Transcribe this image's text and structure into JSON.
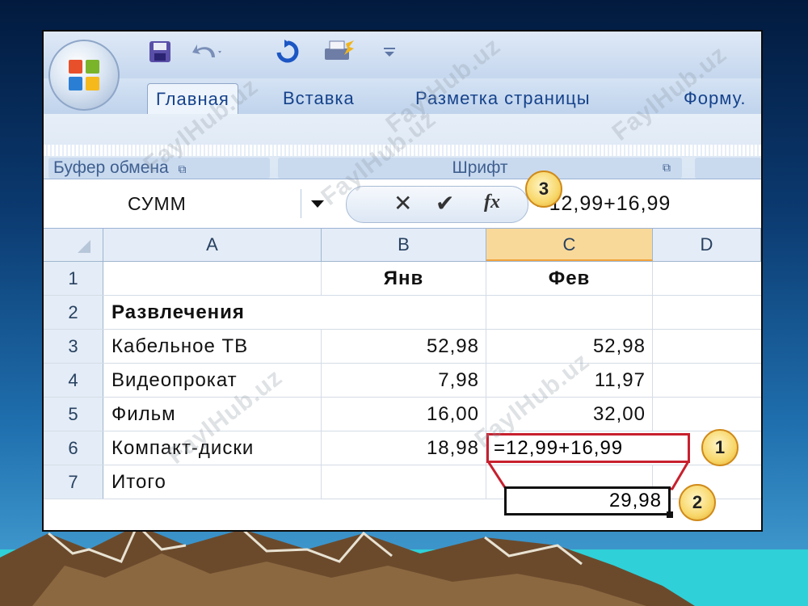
{
  "quick_access": {
    "icons": [
      "office-logo",
      "save-icon",
      "undo-icon",
      "redo-icon",
      "print-icon",
      "customize-icon"
    ]
  },
  "tabs": [
    "Главная",
    "Вставка",
    "Разметка страницы",
    "Форму."
  ],
  "ribbon": {
    "groups": [
      {
        "label": "Буфер обмена",
        "launcher": "⧉"
      },
      {
        "label": "Шрифт",
        "launcher": "⧉"
      }
    ]
  },
  "formula_bar": {
    "name_box": "СУММ",
    "cancel_icon": "✕",
    "enter_icon": "✔",
    "fx_label": "fx",
    "formula": "=12,99+16,99"
  },
  "sheet": {
    "columns": [
      "A",
      "B",
      "C",
      "D"
    ],
    "selected_column": "C",
    "rows": [
      {
        "num": "1",
        "a": "",
        "b": "Янв",
        "c": "Фев"
      },
      {
        "num": "2",
        "a": "Развлечения",
        "b": "",
        "c": ""
      },
      {
        "num": "3",
        "a": "Кабельное ТВ",
        "b": "52,98",
        "c": "52,98"
      },
      {
        "num": "4",
        "a": "Видеопрокат",
        "b": "7,98",
        "c": "11,97"
      },
      {
        "num": "5",
        "a": "Фильм",
        "b": "16,00",
        "c": "32,00"
      },
      {
        "num": "6",
        "a": "Компакт-диски",
        "b": "18,98",
        "c": "=12,99+16,99"
      },
      {
        "num": "7",
        "a": "Итого",
        "b": "",
        "c": ""
      }
    ],
    "result": "29,98"
  },
  "callouts": [
    "1",
    "2",
    "3"
  ],
  "watermark": "FaylHub.uz",
  "colors": {
    "edit_border": "#c8202e",
    "selected_header": "#f9d99a",
    "callout": "#f8d76a",
    "ribbon_text": "#15428b"
  }
}
